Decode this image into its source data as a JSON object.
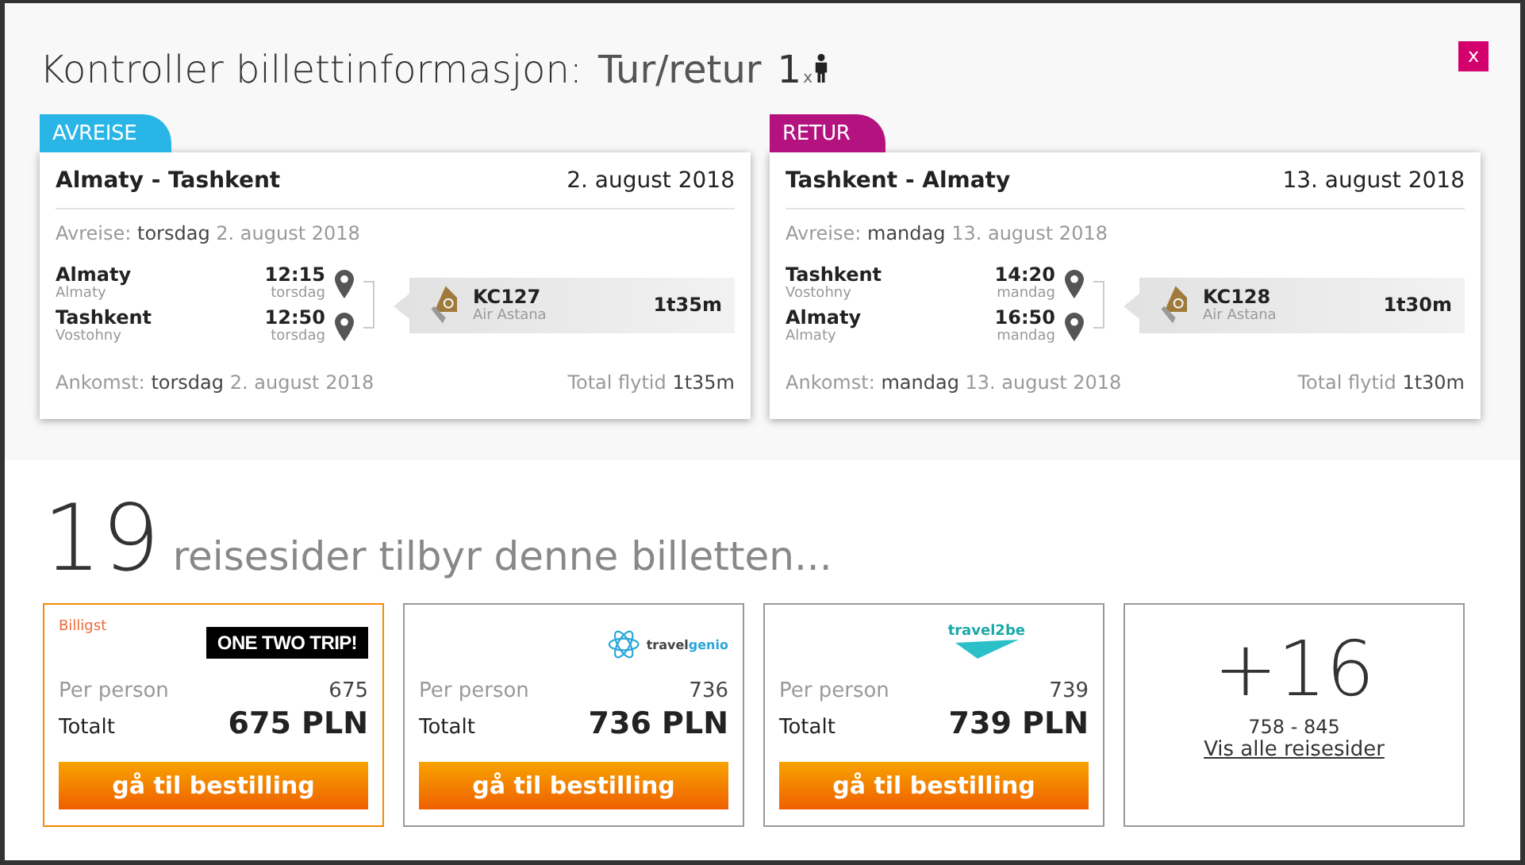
{
  "header": {
    "title": "Kontroller billettinformasjon:",
    "trip_type": "Tur/retur",
    "passengers": "1",
    "passengers_x": "x",
    "close": "x"
  },
  "legs": [
    {
      "tab": "AVREISE",
      "color": "#29b6e6",
      "route": "Almaty - Tashkent",
      "date": "2. august 2018",
      "depart_label": "Avreise:",
      "depart_day": "torsdag",
      "depart_date": "2. august 2018",
      "stops": [
        {
          "city": "Almaty",
          "airport": "Almaty",
          "time": "12:15",
          "day": "torsdag"
        },
        {
          "city": "Tashkent",
          "airport": "Vostohny",
          "time": "12:50",
          "day": "torsdag"
        }
      ],
      "flight": "KC127",
      "airline": "Air Astana",
      "duration": "1t35m",
      "arrive_label": "Ankomst:",
      "arrive_day": "torsdag",
      "arrive_date": "2. august 2018",
      "total_label": "Total flytid",
      "total": "1t35m"
    },
    {
      "tab": "RETUR",
      "color": "#b3127f",
      "route": "Tashkent - Almaty",
      "date": "13. august 2018",
      "depart_label": "Avreise:",
      "depart_day": "mandag",
      "depart_date": "13. august 2018",
      "stops": [
        {
          "city": "Tashkent",
          "airport": "Vostohny",
          "time": "14:20",
          "day": "mandag"
        },
        {
          "city": "Almaty",
          "airport": "Almaty",
          "time": "16:50",
          "day": "mandag"
        }
      ],
      "flight": "KC128",
      "airline": "Air Astana",
      "duration": "1t30m",
      "arrive_label": "Ankomst:",
      "arrive_day": "mandag",
      "arrive_date": "13. august 2018",
      "total_label": "Total flytid",
      "total": "1t30m"
    }
  ],
  "summary": {
    "count": "19",
    "text": "reisesider tilbyr denne billetten..."
  },
  "offers": [
    {
      "highlighted": true,
      "badge": "Billigst",
      "logo": {
        "kind": "onetwotrip",
        "text": "ONE TWO TRIP!"
      },
      "per_person_label": "Per person",
      "per_person": "675",
      "total_label": "Totalt",
      "total": "675 PLN",
      "button": "gå til bestilling"
    },
    {
      "highlighted": false,
      "logo": {
        "kind": "travelgenio",
        "text": "travel",
        "text2": "genio"
      },
      "per_person_label": "Per person",
      "per_person": "736",
      "total_label": "Totalt",
      "total": "736 PLN",
      "button": "gå til bestilling"
    },
    {
      "highlighted": false,
      "logo": {
        "kind": "travel2be",
        "text": "travel2be"
      },
      "per_person_label": "Per person",
      "per_person": "739",
      "total_label": "Totalt",
      "total": "739 PLN",
      "button": "gå til bestilling"
    }
  ],
  "more": {
    "count": "+16",
    "range": "758 - 845",
    "link": "Vis alle reisesider"
  }
}
